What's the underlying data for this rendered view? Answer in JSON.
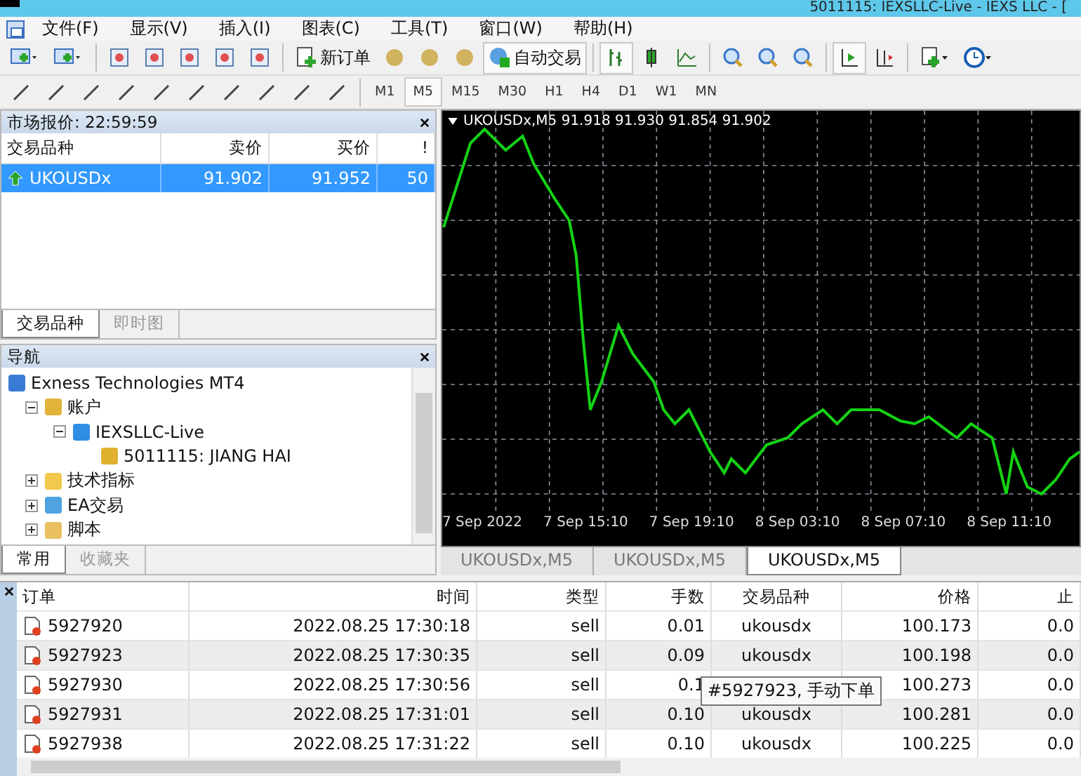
{
  "window": {
    "title": "5011115: IEXSLLC-Live - IEXS LLC - ["
  },
  "menu": [
    "文件(F)",
    "显示(V)",
    "插入(I)",
    "图表(C)",
    "工具(T)",
    "窗口(W)",
    "帮助(H)"
  ],
  "toolbar": {
    "new_order": "新订单",
    "auto_trading": {
      "label": "自动交易",
      "on": true
    },
    "bar_chart_on": true,
    "autoscroll_on": true
  },
  "timeframes": [
    {
      "label": "M1",
      "selected": false
    },
    {
      "label": "M5",
      "selected": true
    },
    {
      "label": "M15",
      "selected": false
    },
    {
      "label": "M30",
      "selected": false
    },
    {
      "label": "H1",
      "selected": false
    },
    {
      "label": "H4",
      "selected": false
    },
    {
      "label": "D1",
      "selected": false
    },
    {
      "label": "W1",
      "selected": false
    },
    {
      "label": "MN",
      "selected": false
    }
  ],
  "market_watch": {
    "title": "市场报价: 22:59:59",
    "columns": [
      "交易品种",
      "卖价",
      "买价",
      "!"
    ],
    "rows": [
      {
        "symbol": "UKOUSDx",
        "bid": "91.902",
        "ask": "91.952",
        "spread": "50",
        "selected": true
      }
    ],
    "tabs": [
      {
        "label": "交易品种",
        "selected": true
      },
      {
        "label": "即时图",
        "selected": false
      }
    ]
  },
  "navigator": {
    "title": "导航",
    "tree": [
      {
        "label": "Exness Technologies MT4",
        "kind": "root",
        "children": [
          {
            "label": "账户",
            "kind": "accounts",
            "expanded": true,
            "children": [
              {
                "label": "IEXSLLC-Live",
                "kind": "server",
                "expanded": true,
                "children": [
                  {
                    "label": "5011115: JIANG HAI",
                    "kind": "user"
                  }
                ]
              }
            ]
          },
          {
            "label": "技术指标",
            "kind": "indicators",
            "expanded": false
          },
          {
            "label": "EA交易",
            "kind": "experts",
            "expanded": false
          },
          {
            "label": "脚本",
            "kind": "scripts",
            "expanded": false
          }
        ]
      }
    ],
    "tabs": [
      {
        "label": "常用",
        "selected": true
      },
      {
        "label": "收藏夹",
        "selected": false
      }
    ]
  },
  "chart": {
    "header": "UKOUSDx,M5  91.918 91.930 91.854 91.902",
    "time_labels": [
      "7 Sep 2022",
      "7 Sep 15:10",
      "7 Sep 19:10",
      "8 Sep 03:10",
      "8 Sep 07:10",
      "8 Sep 11:10"
    ],
    "tabs": [
      {
        "label": "UKOUSDx,M5",
        "selected": false
      },
      {
        "label": "UKOUSDx,M5",
        "selected": false
      },
      {
        "label": "UKOUSDx,M5",
        "selected": true
      }
    ]
  },
  "terminal": {
    "columns": [
      "订单",
      "时间",
      "类型",
      "手数",
      "交易品种",
      "价格",
      "止"
    ],
    "rows": [
      {
        "order": "5927920",
        "time": "2022.08.25 17:30:18",
        "type": "sell",
        "lots": "0.01",
        "symbol": "ukousdx",
        "price": "100.173",
        "sl": "0.0"
      },
      {
        "order": "5927923",
        "time": "2022.08.25 17:30:35",
        "type": "sell",
        "lots": "0.09",
        "symbol": "ukousdx",
        "price": "100.198",
        "sl": "0.0"
      },
      {
        "order": "5927930",
        "time": "2022.08.25 17:30:56",
        "type": "sell",
        "lots": "0.1",
        "price": "100.273",
        "sl": "0.0"
      },
      {
        "order": "5927931",
        "time": "2022.08.25 17:31:01",
        "type": "sell",
        "lots": "0.10",
        "symbol": "ukousdx",
        "price": "100.281",
        "sl": "0.0"
      },
      {
        "order": "5927938",
        "time": "2022.08.25 17:31:22",
        "type": "sell",
        "lots": "0.10",
        "symbol": "ukousdx",
        "price": "100.225",
        "sl": "0.0"
      }
    ],
    "tooltip": "#5927923, 手动下单"
  }
}
